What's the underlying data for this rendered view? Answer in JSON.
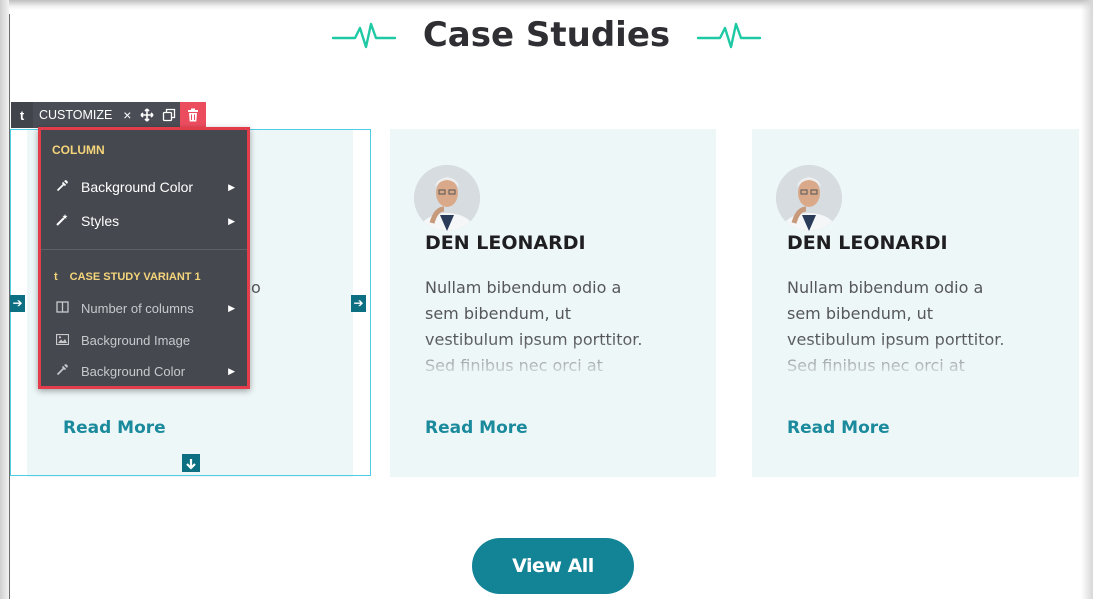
{
  "section": {
    "title": "Case Studies"
  },
  "cards": [
    {
      "name": "",
      "excerpt_visible": "o",
      "read_more": "Read More"
    },
    {
      "name": "DEN LEONARDI",
      "excerpt": "Nullam bibendum odio a sem bibendum, ut vestibulum ipsum porttitor. Sed finibus nec orci at cursus",
      "read_more": "Read More"
    },
    {
      "name": "DEN LEONARDI",
      "excerpt": "Nullam bibendum odio a sem bibendum, ut vestibulum ipsum porttitor. Sed finibus nec orci at cursus",
      "read_more": "Read More"
    }
  ],
  "toolbar": {
    "logo": "t",
    "customize": "CUSTOMIZE",
    "close": "×",
    "move_icon": "move-icon",
    "copy_icon": "copy-icon",
    "delete_icon": "trash-icon"
  },
  "menu": {
    "column_section": "COLUMN",
    "column_items": [
      {
        "label": "Background Color",
        "icon": "dropper-icon"
      },
      {
        "label": "Styles",
        "icon": "magic-wand-icon"
      }
    ],
    "variant_section": "CASE STUDY VARIANT 1",
    "variant_logo": "t",
    "variant_items": [
      {
        "label": "Number of columns",
        "icon": "columns-icon"
      },
      {
        "label": "Background Image",
        "icon": "image-icon"
      },
      {
        "label": "Background Color",
        "icon": "dropper-icon"
      }
    ]
  },
  "cta": {
    "view_all": "View All"
  },
  "colors": {
    "accent": "#138396",
    "card_bg": "#eef7f8",
    "toolbar_bg": "#4a4d55",
    "delete_bg": "#ec4d5e",
    "menu_border": "#e33d4c",
    "section_label": "#f5d57b",
    "selection_border": "#4fcde6",
    "pulse_icon": "#1ec9a3"
  }
}
